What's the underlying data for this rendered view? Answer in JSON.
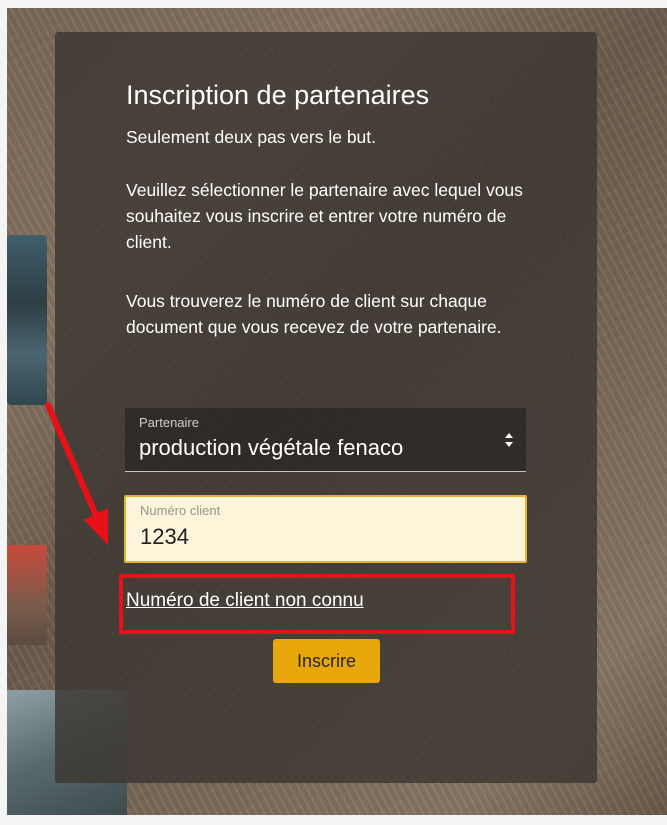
{
  "form": {
    "title": "Inscription de partenaires",
    "subtitle": "Seulement deux pas vers le but.",
    "paragraph_1": "Veuillez sélectionner le partenaire avec lequel vous souhaitez vous inscrire et entrer votre numéro de client.",
    "paragraph_2": "Vous trouverez le numéro de client sur chaque document que vous recevez de votre partenaire.",
    "partner_select": {
      "label": "Partenaire",
      "selected_value": "production végétale fenaco"
    },
    "customer_number": {
      "label": "Numéro client",
      "value": "1234"
    },
    "unknown_number_link": "Numéro de client non connu",
    "submit_label": "Inscrire"
  },
  "annotation": {
    "highlight_color": "#e8111a",
    "arrow_color": "#e8111a"
  },
  "colors": {
    "accent": "#e8a80c",
    "input_border": "#e6b32c",
    "input_background": "#fcf5da",
    "card_background": "#3c3732"
  }
}
